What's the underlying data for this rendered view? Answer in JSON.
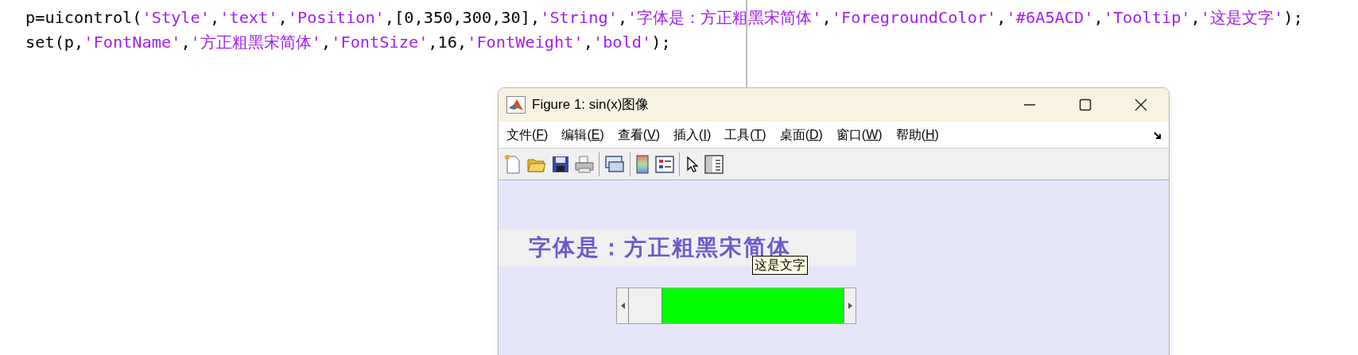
{
  "code_lines": [
    [
      {
        "kind": "code",
        "text": "p=uicontrol("
      },
      {
        "kind": "string",
        "text": "'Style'"
      },
      {
        "kind": "code",
        "text": ","
      },
      {
        "kind": "string",
        "text": "'text'"
      },
      {
        "kind": "code",
        "text": ","
      },
      {
        "kind": "string",
        "text": "'Position'"
      },
      {
        "kind": "code",
        "text": ",[0,350,300,30],"
      },
      {
        "kind": "string",
        "text": "'String'"
      },
      {
        "kind": "code",
        "text": ","
      },
      {
        "kind": "string",
        "text": "'字体是：方正粗黑宋简体'"
      },
      {
        "kind": "code",
        "text": ","
      },
      {
        "kind": "string",
        "text": "'ForegroundColor'"
      },
      {
        "kind": "code",
        "text": ","
      },
      {
        "kind": "string",
        "text": "'#6A5ACD'"
      },
      {
        "kind": "code",
        "text": ","
      },
      {
        "kind": "string",
        "text": "'Tooltip'"
      },
      {
        "kind": "code",
        "text": ","
      },
      {
        "kind": "string",
        "text": "'这是文字'"
      },
      {
        "kind": "code",
        "text": ");"
      }
    ],
    [
      {
        "kind": "code",
        "text": "set(p,"
      },
      {
        "kind": "string",
        "text": "'FontName'"
      },
      {
        "kind": "code",
        "text": ","
      },
      {
        "kind": "string",
        "text": "'方正粗黑宋简体'"
      },
      {
        "kind": "code",
        "text": ","
      },
      {
        "kind": "string",
        "text": "'FontSize'"
      },
      {
        "kind": "code",
        "text": ",16,"
      },
      {
        "kind": "string",
        "text": "'FontWeight'"
      },
      {
        "kind": "code",
        "text": ","
      },
      {
        "kind": "string",
        "text": "'bold'"
      },
      {
        "kind": "code",
        "text": ");"
      }
    ]
  ],
  "figure_window": {
    "title": "Figure 1: sin(x)图像",
    "menu": [
      "文件(F)",
      "编辑(E)",
      "查看(V)",
      "插入(I)",
      "工具(T)",
      "桌面(D)",
      "窗口(W)",
      "帮助(H)"
    ],
    "text_control": {
      "text": "字体是：方正粗黑宋简体",
      "color": "#6a5acd"
    },
    "tooltip": "这是文字",
    "slider": {
      "level": 0
    }
  }
}
